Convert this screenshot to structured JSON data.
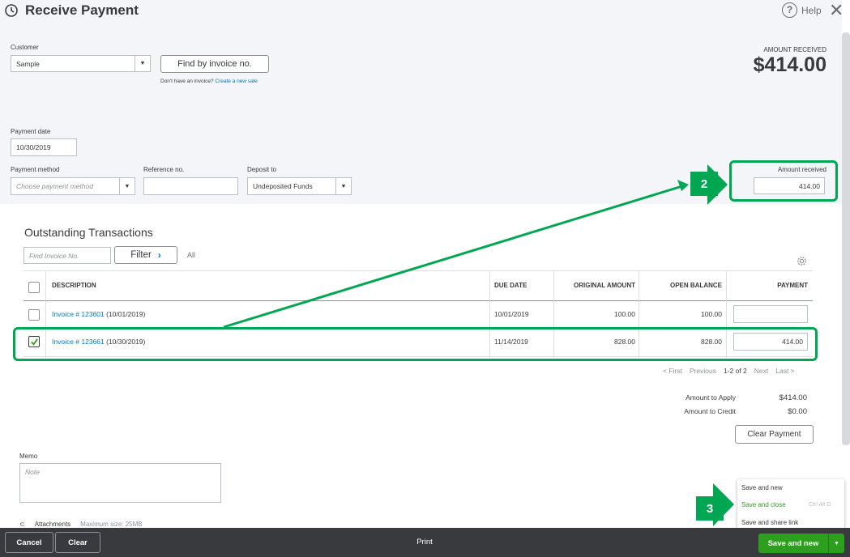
{
  "header": {
    "title": "Receive Payment",
    "help_label": "Help",
    "help_glyph": "?",
    "close_glyph": "✕"
  },
  "customer": {
    "label": "Customer",
    "value": "Sample",
    "find_button": "Find by invoice no.",
    "no_invoice_text": "Don't have an invoice?",
    "create_sale_link": "Create a new sale"
  },
  "amount_received_summary": {
    "label": "AMOUNT RECEIVED",
    "value": "$414.00"
  },
  "payment_date": {
    "label": "Payment date",
    "value": "10/30/2019"
  },
  "payment_method": {
    "label": "Payment method",
    "placeholder": "Choose payment method"
  },
  "reference": {
    "label": "Reference no.",
    "value": ""
  },
  "deposit_to": {
    "label": "Deposit to",
    "value": "Undeposited Funds"
  },
  "amount_received": {
    "label": "Amount received",
    "value": "414.00"
  },
  "outstanding": {
    "title": "Outstanding Transactions",
    "find_placeholder": "Find Invoice No.",
    "filter_label": "Filter",
    "filter_chevron": "›",
    "all_label": "All",
    "columns": [
      "DESCRIPTION",
      "DUE DATE",
      "ORIGINAL AMOUNT",
      "OPEN BALANCE",
      "PAYMENT"
    ],
    "rows": [
      {
        "invoice": "Invoice # 123601",
        "date": "(10/01/2019)",
        "due": "10/01/2019",
        "original": "100.00",
        "open": "100.00",
        "payment": "",
        "checked": false
      },
      {
        "invoice": "Invoice # 123661",
        "date": "(10/30/2019)",
        "due": "11/14/2019",
        "original": "828.00",
        "open": "828.00",
        "payment": "414.00",
        "checked": true
      }
    ],
    "pagination": {
      "first": "< First",
      "previous": "Previous",
      "range": "1-2 of 2",
      "next": "Next",
      "last": "Last >"
    }
  },
  "totals": {
    "apply_label": "Amount to Apply",
    "apply_value": "$414.00",
    "credit_label": "Amount to Credit",
    "credit_value": "$0.00",
    "clear_button": "Clear Payment"
  },
  "memo": {
    "label": "Memo",
    "placeholder": "Note"
  },
  "attachments": {
    "label": "Attachments",
    "max_size": "Maximum size: 25MB"
  },
  "footer": {
    "cancel": "Cancel",
    "clear": "Clear",
    "print": "Print",
    "save_new": "Save and new"
  },
  "save_menu": {
    "items": [
      "Save and new",
      "Save and close",
      "Save and share link"
    ],
    "shortcut": "Ctrl Alt D"
  },
  "annotations": {
    "step2": "2",
    "step3": "3",
    "color": "#00a651"
  },
  "colors": {
    "accent_green": "#2ca01c",
    "link_blue": "#0077c5",
    "footer_bg": "#393a3d"
  }
}
